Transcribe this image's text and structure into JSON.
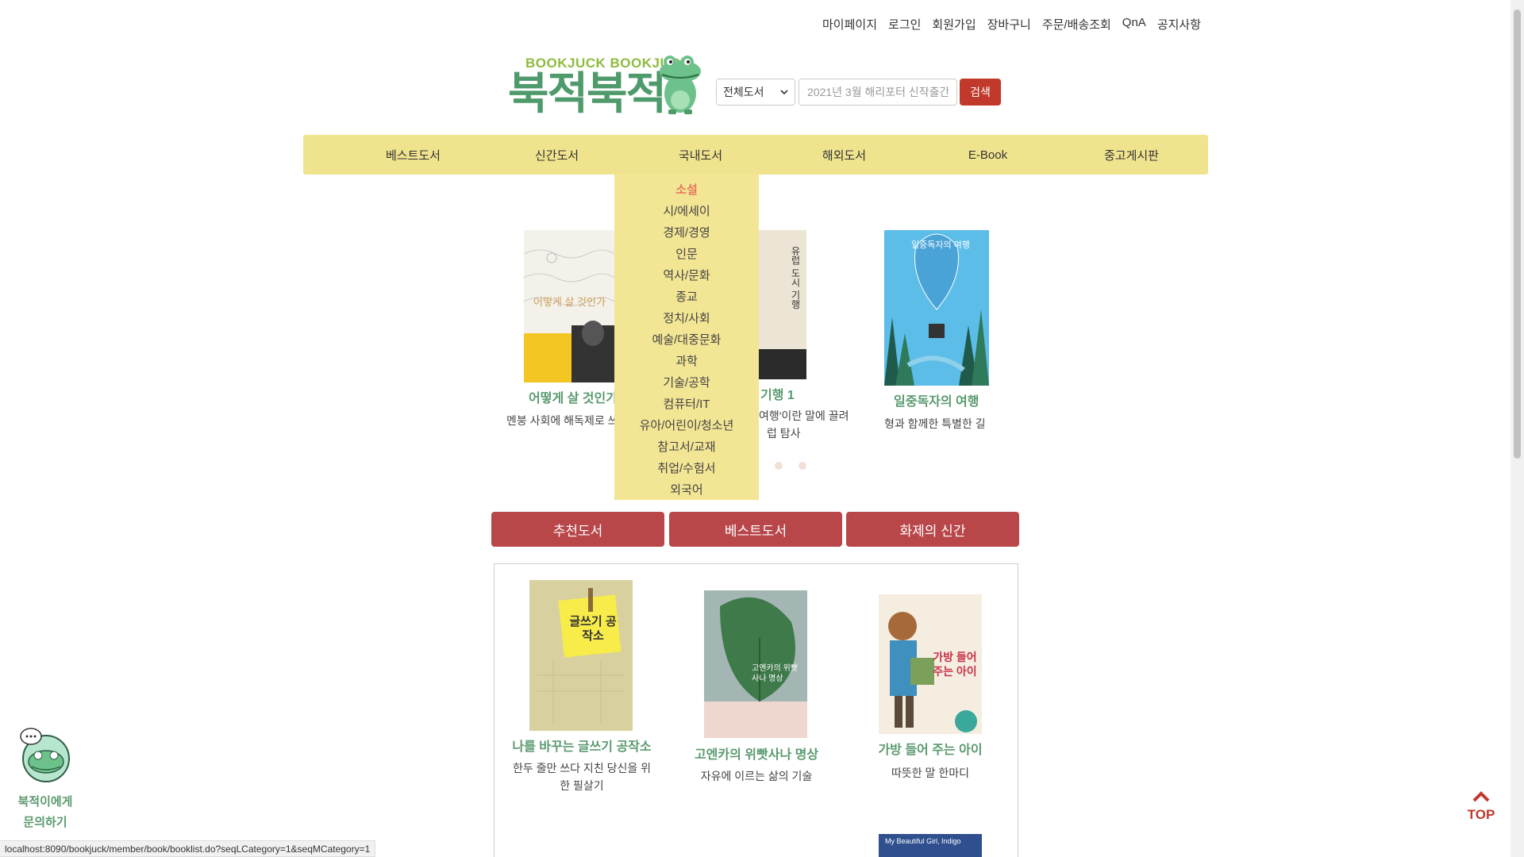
{
  "top_links": [
    "마이페이지",
    "로그인",
    "회원가입",
    "장바구니",
    "주문/배송조회",
    "QnA",
    "공지사항"
  ],
  "logo": {
    "sub": "BOOKJUCK BOOKJUCK",
    "main": "북적북적"
  },
  "search": {
    "category": "전체도서",
    "placeholder": "2021년 3월 해리포터 신작출간",
    "button": "검색"
  },
  "nav": [
    "베스트도서",
    "신간도서",
    "국내도서",
    "해외도서",
    "E-Book",
    "중고게시판"
  ],
  "dropdown": {
    "active": "소설",
    "items": [
      "시/에세이",
      "경제/경영",
      "인문",
      "역사/문화",
      "종교",
      "정치/사회",
      "예술/대중문화",
      "과학",
      "기술/공학",
      "컴퓨터/IT",
      "유아/어린이/청소년",
      "참고서/교재",
      "취업/수험서",
      "외국어"
    ]
  },
  "carousel": [
    {
      "title": "어떻게 살 것인가",
      "desc": "멘붕 사회에 해독제로 쓰",
      "cover_text": "어떻게 살 것인가"
    },
    {
      "title": "기행 1",
      "desc1": "여행'이란 말에 끌려",
      "desc2": "럽 탐사",
      "cover_text": "유럽 도시 기행 1"
    },
    {
      "title": "일중독자의 여행",
      "desc": "형과 함께한 특별한 길",
      "cover_text": "일중독자의 여행"
    }
  ],
  "tabs": [
    "추천도서",
    "베스트도서",
    "화제의 신간"
  ],
  "grid_books": [
    {
      "title": "나를 바꾸는 글쓰기 공작소",
      "desc": "한두 줄만 쓰다 지친 당신을 위한 필살기",
      "cover_text": "글쓰기 공작소"
    },
    {
      "title": "고엔카의 위빳사나 명상",
      "desc": "자유에 이르는 삶의 기술",
      "cover_text": "고엔카의 위빳사나 명상"
    },
    {
      "title": "가방 들어 주는 아이",
      "desc": "따뜻한 말 한마디",
      "cover_text": "가방 들어 주는 아이"
    }
  ],
  "chat": {
    "line1": "북적이에게",
    "line2": "문의하기"
  },
  "top_button": "TOP",
  "status_url": "localhost:8090/bookjuck/member/book/booklist.do?seqLCategory=1&seqMCategory=1",
  "colors": {
    "nav_bg": "#f0e38e",
    "accent_red": "#b9474a",
    "title_green": "#5a9a6e",
    "dropdown_active": "#e8795f"
  }
}
